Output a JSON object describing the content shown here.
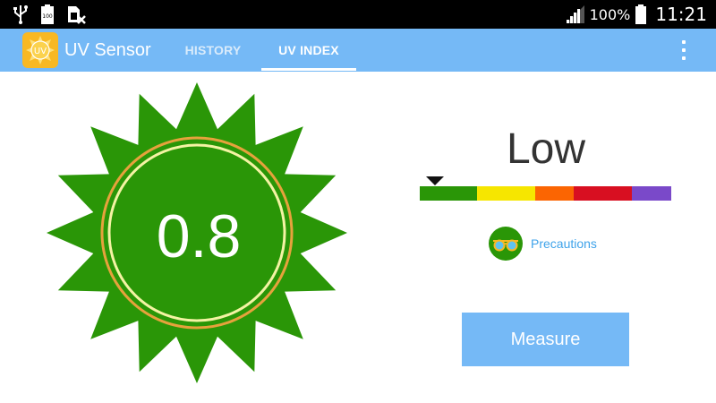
{
  "status_bar": {
    "battery_percent": "100%",
    "time": "11:21",
    "notification_icons": [
      "usb-icon",
      "battery-100-icon",
      "sim-off-icon"
    ],
    "signal_icon": "signal-bars-icon",
    "battery_icon": "battery-icon"
  },
  "app_bar": {
    "title": "UV Sensor",
    "logo_text": "UV",
    "logo_icon": "sun-logo-icon",
    "tabs": [
      {
        "label": "HISTORY",
        "selected": false
      },
      {
        "label": "UV INDEX",
        "selected": true
      }
    ],
    "menu_icon": "overflow-menu-icon"
  },
  "main": {
    "uv_value": "0.8",
    "level_label": "Low",
    "scale_fraction": 0.06,
    "precautions_label": "Precautions",
    "precautions_icon": "sunglasses-icon",
    "measure_label": "Measure"
  },
  "colors": {
    "status_bar": "#000000",
    "app_bar": "#75b9f6",
    "sun_green": "#2a9607",
    "ring_orange": "#e6a23c",
    "ring_yellow": "#f4f3a3",
    "scale_green": "#2a9607",
    "scale_yellow": "#f6e600",
    "scale_orange": "#fb6502",
    "scale_red": "#d80f21",
    "scale_violet": "#7a49c9",
    "link_blue": "#3fa3ea",
    "button_blue": "#75b9f6"
  }
}
